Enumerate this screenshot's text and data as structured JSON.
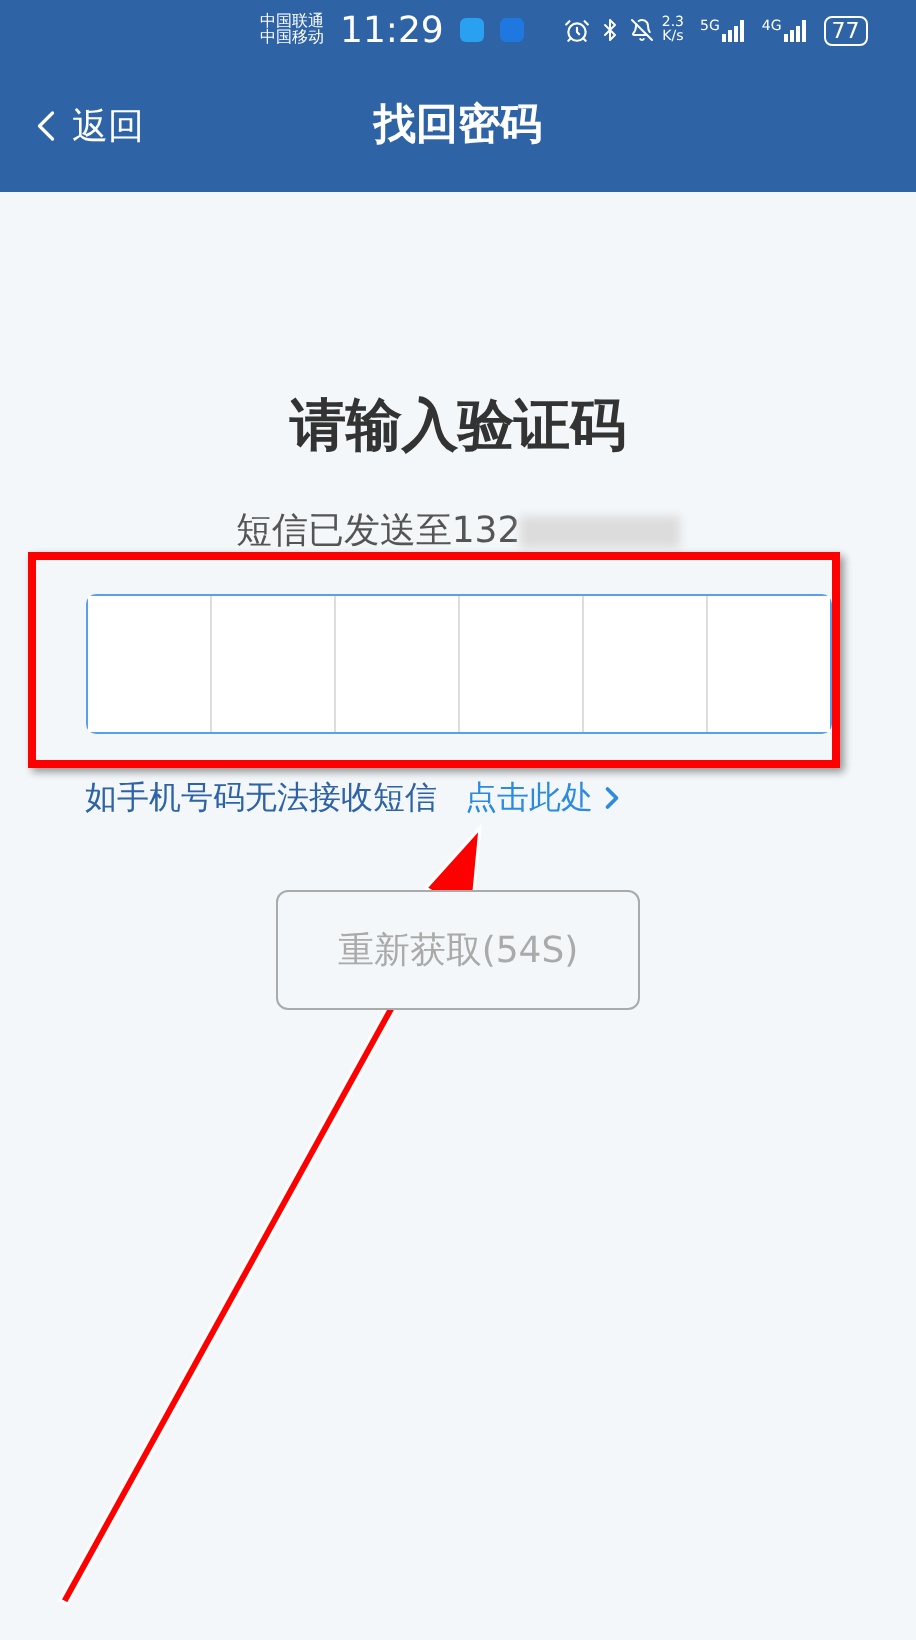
{
  "status_bar": {
    "carriers": [
      "中国联通",
      "中国移动"
    ],
    "time": "11:29",
    "speed_value": "2.3",
    "speed_unit": "K/s",
    "networks": [
      "5G",
      "4G"
    ],
    "battery": "77"
  },
  "header": {
    "back": "返回",
    "title": "找回密码"
  },
  "heading": "请输入验证码",
  "sent_to": "短信已发送至132",
  "code_input": {
    "focused": true,
    "cells": [
      {
        "filled": false
      },
      {
        "filled": false
      },
      {
        "filled": false
      },
      {
        "filled": false
      },
      {
        "filled": false
      },
      {
        "filled": false
      }
    ]
  },
  "help": {
    "text": "如手机号码无法接收短信",
    "link": "点击此处"
  },
  "resend_button": {
    "label": "重新获取(54S)",
    "disabled": true
  }
}
